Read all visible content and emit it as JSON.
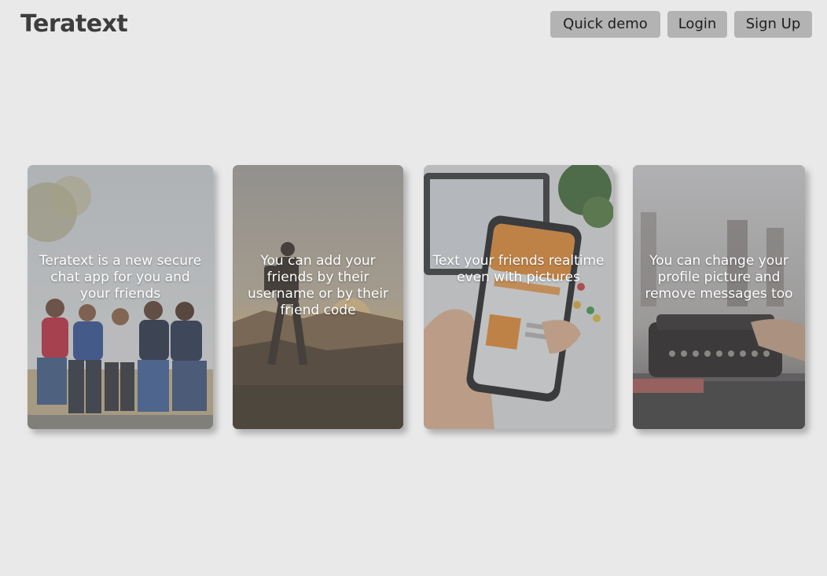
{
  "header": {
    "brand": "Teratext",
    "buttons": {
      "quick_demo": "Quick demo",
      "login": "Login",
      "sign_up": "Sign Up"
    }
  },
  "features": [
    {
      "caption": "Teratext is a new secure chat app for you and your friends",
      "image": "friends-sitting-photo"
    },
    {
      "caption": "You can add your friends by their username or by their friend code",
      "image": "hiker-sunset-photo"
    },
    {
      "caption": "Text your friends realtime even with pictures",
      "image": "hand-holding-phone-photo"
    },
    {
      "caption": "You can change your profile picture and remove messages too",
      "image": "typewriter-desk-photo"
    }
  ],
  "colors": {
    "background": "#e9e9e9",
    "button": "#b3b3b3",
    "brand_text": "#3d3d3d",
    "caption_text": "#ffffff"
  }
}
